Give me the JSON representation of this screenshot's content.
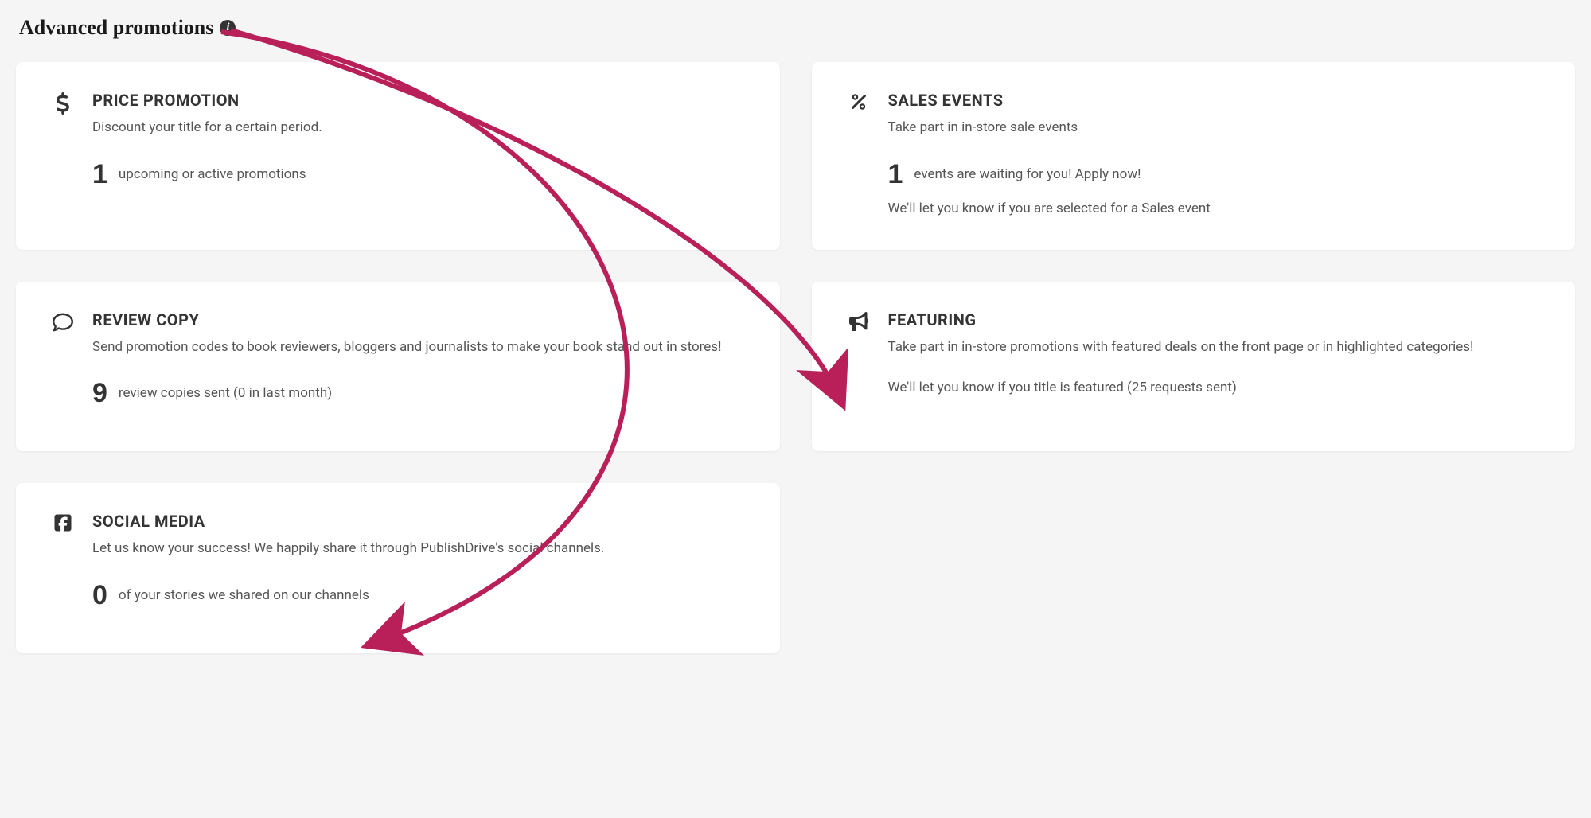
{
  "page": {
    "title": "Advanced promotions"
  },
  "cards": {
    "price_promotion": {
      "title": "PRICE PROMOTION",
      "desc": "Discount your title for a certain period.",
      "stat_number": "1",
      "stat_text": "upcoming or active promotions"
    },
    "sales_events": {
      "title": "SALES EVENTS",
      "desc": "Take part in in-store sale events",
      "stat_number": "1",
      "stat_text": "events are waiting for you! Apply now!",
      "note": "We'll let you know if you are selected for a Sales event"
    },
    "review_copy": {
      "title": "REVIEW COPY",
      "desc": "Send promotion codes to book reviewers, bloggers and journalists to make your book stand out in stores!",
      "stat_number": "9",
      "stat_text": "review copies sent (0 in last month)"
    },
    "featuring": {
      "title": "FEATURING",
      "desc": "Take part in in-store promotions with featured deals on the front page or in highlighted categories!",
      "note": "We'll let you know if you title is featured (25 requests sent)"
    },
    "social_media": {
      "title": "SOCIAL MEDIA",
      "desc": "Let us know your success! We happily share it through PublishDrive's social channels.",
      "stat_number": "0",
      "stat_text": "of your stories we shared on our channels"
    }
  },
  "annotation": {
    "arrow_color": "#b92059"
  }
}
